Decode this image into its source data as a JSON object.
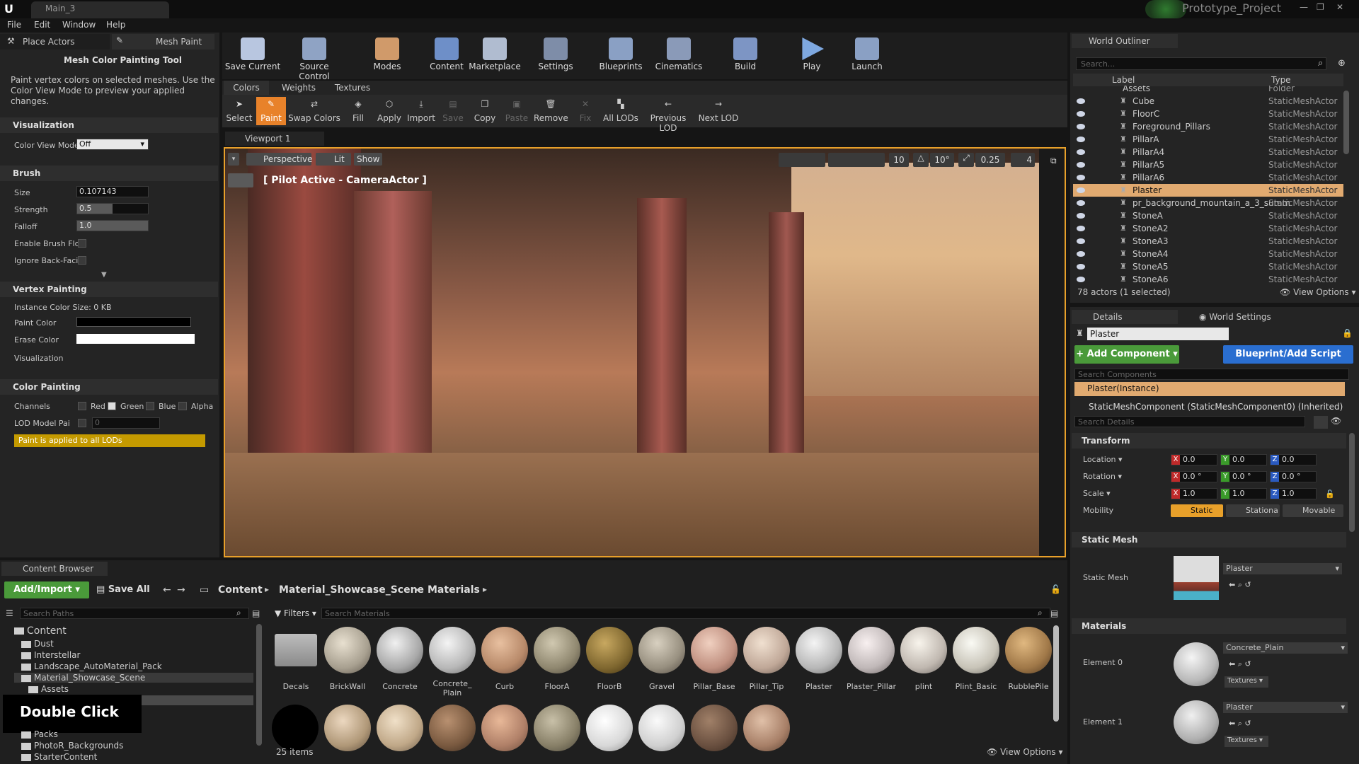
{
  "window": {
    "tab_title": "Main_3",
    "project_name": "Prototype_Project"
  },
  "menu": [
    "File",
    "Edit",
    "Window",
    "Help"
  ],
  "mode_tabs": {
    "place_actors": "Place Actors",
    "mesh_paint": "Mesh Paint"
  },
  "tool_panel": {
    "title": "Mesh Color Painting Tool",
    "description": "Paint vertex colors on selected meshes.  Use the Color View Mode to preview your applied changes.",
    "visualization": {
      "header": "Visualization",
      "color_view_mode_label": "Color View Mode",
      "color_view_mode_value": "Off"
    },
    "brush": {
      "header": "Brush",
      "size_label": "Size",
      "size_value": "0.107143",
      "strength_label": "Strength",
      "strength_value": "0.5",
      "falloff_label": "Falloff",
      "falloff_value": "1.0",
      "enable_brush_flow_label": "Enable Brush Flo",
      "ignore_back_facing_label": "Ignore Back-Faci"
    },
    "vertex_painting": {
      "header": "Vertex Painting",
      "instance_color_size": "Instance Color Size: 0 KB",
      "paint_color_label": "Paint Color",
      "erase_color_label": "Erase Color",
      "visualization_label": "Visualization"
    },
    "color_painting": {
      "header": "Color Painting",
      "channels_label": "Channels",
      "red": "Red",
      "green": "Green",
      "blue": "Blue",
      "alpha": "Alpha",
      "lod_label": "LOD Model Pai",
      "lod_value": "0",
      "warning": "Paint is applied to all LODs"
    }
  },
  "toolbar": [
    "Save Current",
    "Source Control",
    "Modes",
    "Content",
    "Marketplace",
    "Settings",
    "Blueprints",
    "Cinematics",
    "Build",
    "Play",
    "Launch"
  ],
  "paint_tabs": [
    "Colors",
    "Weights",
    "Textures"
  ],
  "paint_tools": [
    "Select",
    "Paint",
    "Swap Colors",
    "Fill",
    "Apply",
    "Import",
    "Save",
    "Copy",
    "Paste",
    "Remove",
    "Fix",
    "All LODs",
    "Previous LOD",
    "Next LOD"
  ],
  "viewport": {
    "tab": "Viewport 1",
    "perspective": "Perspective",
    "lit": "Lit",
    "show": "Show",
    "pilot": "[ Pilot Active - CameraActor ]",
    "grid_snap": "10",
    "rotation_snap": "10°",
    "scale_snap": "0.25",
    "camera_speed": "4"
  },
  "outliner": {
    "title": "World Outliner",
    "search_placeholder": "Search...",
    "col_label": "Label",
    "col_type": "Type",
    "folder": {
      "name": "Assets",
      "type": "Folder"
    },
    "rows": [
      {
        "name": "Cube",
        "type": "StaticMeshActor"
      },
      {
        "name": "FloorC",
        "type": "StaticMeshActor"
      },
      {
        "name": "Foreground_Pillars",
        "type": "StaticMeshActor"
      },
      {
        "name": "PillarA",
        "type": "StaticMeshActor"
      },
      {
        "name": "PillarA4",
        "type": "StaticMeshActor"
      },
      {
        "name": "PillarA5",
        "type": "StaticMeshActor"
      },
      {
        "name": "PillarA6",
        "type": "StaticMeshActor"
      },
      {
        "name": "Plaster",
        "type": "StaticMeshActor"
      },
      {
        "name": "pr_background_mountain_a_3_summ",
        "type": "StaticMeshActor"
      },
      {
        "name": "StoneA",
        "type": "StaticMeshActor"
      },
      {
        "name": "StoneA2",
        "type": "StaticMeshActor"
      },
      {
        "name": "StoneA3",
        "type": "StaticMeshActor"
      },
      {
        "name": "StoneA4",
        "type": "StaticMeshActor"
      },
      {
        "name": "StoneA5",
        "type": "StaticMeshActor"
      },
      {
        "name": "StoneA6",
        "type": "StaticMeshActor"
      }
    ],
    "count": "78 actors (1 selected)",
    "view_options": "View Options"
  },
  "details": {
    "tab_details": "Details",
    "tab_world_settings": "World Settings",
    "name_value": "Plaster",
    "add_component": "+ Add Component",
    "blueprint": "Blueprint/Add Script",
    "search_components": "Search Components",
    "instance": "Plaster(Instance)",
    "component": "StaticMeshComponent (StaticMeshComponent0) (Inherited)",
    "search_details": "Search Details",
    "transform": {
      "header": "Transform",
      "location": "Location",
      "rotation": "Rotation",
      "scale": "Scale",
      "mobility": "Mobility",
      "loc": [
        "0.0",
        "0.0",
        "0.0"
      ],
      "rot": [
        "0.0 °",
        "0.0 °",
        "0.0 °"
      ],
      "scl": [
        "1.0",
        "1.0",
        "1.0"
      ],
      "static": "Static",
      "stationary": "Stationa",
      "movable": "Movable"
    },
    "static_mesh": {
      "header": "Static Mesh",
      "label": "Static Mesh",
      "value": "Plaster"
    },
    "materials": {
      "header": "Materials",
      "element0": "Element 0",
      "element0_value": "Concrete_Plain",
      "element1": "Element 1",
      "element1_value": "Plaster",
      "textures": "Textures"
    }
  },
  "content_browser": {
    "tab": "Content Browser",
    "add_import": "Add/Import",
    "save_all": "Save All",
    "path": [
      "Content",
      "Material_Showcase_Scene",
      "Materials"
    ],
    "search_paths": "Search Paths",
    "filters": "Filters",
    "search_materials": "Search Materials",
    "tree": [
      "Content",
      "Dust",
      "Interstellar",
      "Landscape_AutoMaterial_Pack",
      "Material_Showcase_Scene",
      "Assets",
      "Packs",
      "PhotoR_Backgrounds",
      "StarterContent"
    ],
    "overlay": "Double Click",
    "assets": [
      "Decals",
      "BrickWall",
      "Concrete",
      "Concrete_ Plain",
      "Curb",
      "FloorA",
      "FloorB",
      "Gravel",
      "Pillar_Base",
      "Pillar_Tip",
      "Plaster",
      "Plaster_Pillar",
      "plint",
      "Plint_Basic",
      "RubblePile"
    ],
    "count": "25 items",
    "view_options": "View Options"
  }
}
